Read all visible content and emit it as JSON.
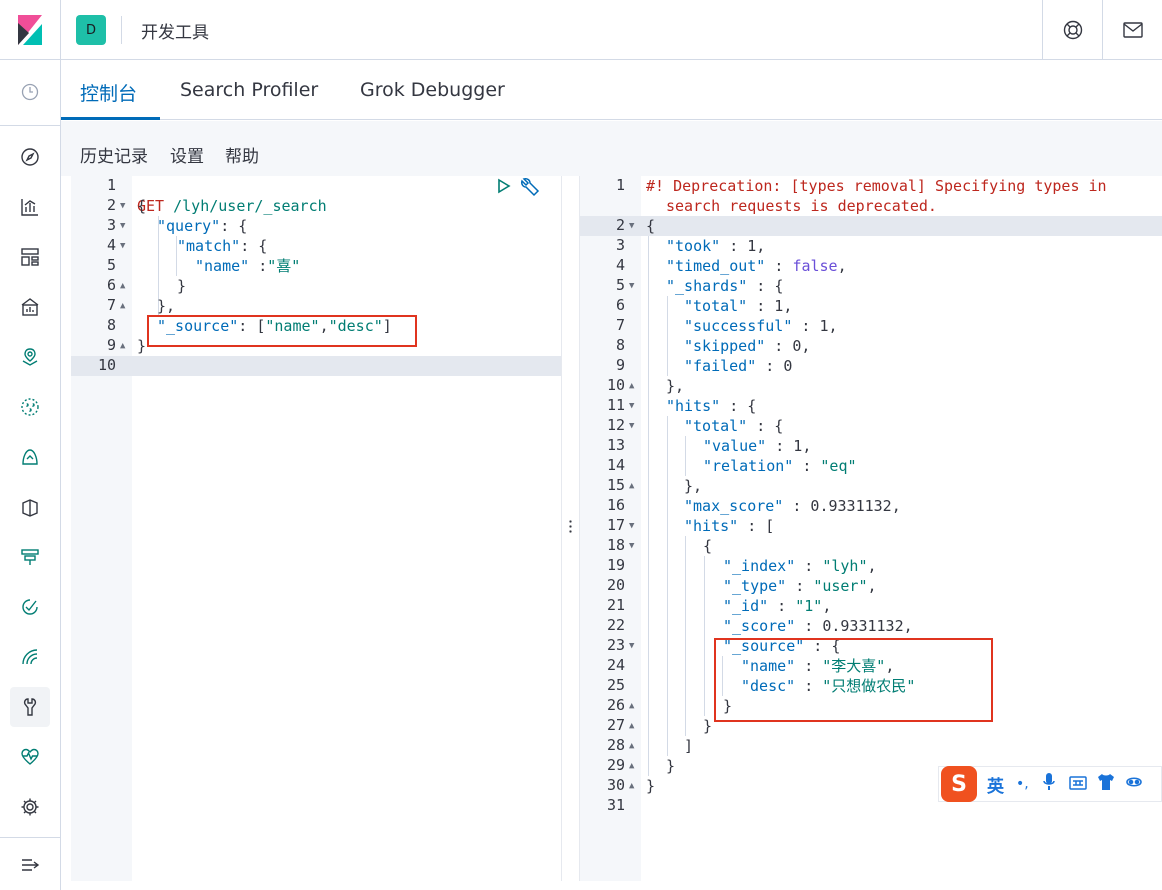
{
  "app": {
    "space_letter": "D",
    "breadcrumb": "开发工具"
  },
  "tabs": [
    {
      "label": "控制台"
    },
    {
      "label": "Search Profiler"
    },
    {
      "label": "Grok Debugger"
    }
  ],
  "subnav": {
    "history": "历史记录",
    "settings": "设置",
    "help": "帮助"
  },
  "request_lines": [
    "1",
    "2",
    "3",
    "4",
    "5",
    "6",
    "7",
    "8",
    "9",
    "10"
  ],
  "request_code": {
    "l1_method": "GET",
    "l1_path": " /lyh/user/_search",
    "l2": "{",
    "l3_key": "\"query\"",
    "l3_rest": ": {",
    "l4_key": "\"match\"",
    "l4_rest": ": {",
    "l5_key": "\"name\"",
    "l5_sep": " :",
    "l5_val": "\"喜\"",
    "l6": "}",
    "l7": "},",
    "l8_key": "\"_source\"",
    "l8_sep": ": [",
    "l8_v1": "\"name\"",
    "l8_comma": ",",
    "l8_v2": "\"desc\"",
    "l8_end": "]",
    "l9": "}"
  },
  "response_lines": [
    "1",
    "2",
    "3",
    "4",
    "5",
    "6",
    "7",
    "8",
    "9",
    "10",
    "11",
    "12",
    "13",
    "14",
    "15",
    "16",
    "17",
    "18",
    "19",
    "20",
    "21",
    "22",
    "23",
    "24",
    "25",
    "26",
    "27",
    "28",
    "29",
    "30",
    "31"
  ],
  "response_code": {
    "r1a": "#! Deprecation: [types removal] Specifying types in",
    "r1b": "search requests is deprecated.",
    "r2": "{",
    "r3k": "\"took\"",
    "r3v": " : 1,",
    "r4k": "\"timed_out\"",
    "r4s": " : ",
    "r4v": "false",
    "r4e": ",",
    "r5k": "\"_shards\"",
    "r5v": " : {",
    "r6k": "\"total\"",
    "r6v": " : 1,",
    "r7k": "\"successful\"",
    "r7v": " : 1,",
    "r8k": "\"skipped\"",
    "r8v": " : 0,",
    "r9k": "\"failed\"",
    "r9v": " : 0",
    "r10": "},",
    "r11k": "\"hits\"",
    "r11v": " : {",
    "r12k": "\"total\"",
    "r12v": " : {",
    "r13k": "\"value\"",
    "r13v": " : 1,",
    "r14k": "\"relation\"",
    "r14s": " : ",
    "r14v": "\"eq\"",
    "r15": "},",
    "r16k": "\"max_score\"",
    "r16v": " : 0.9331132,",
    "r17k": "\"hits\"",
    "r17v": " : [",
    "r18": "{",
    "r19k": "\"_index\"",
    "r19s": " : ",
    "r19v": "\"lyh\"",
    "r19e": ",",
    "r20k": "\"_type\"",
    "r20s": " : ",
    "r20v": "\"user\"",
    "r20e": ",",
    "r21k": "\"_id\"",
    "r21s": " : ",
    "r21v": "\"1\"",
    "r21e": ",",
    "r22k": "\"_score\"",
    "r22v": " : 0.9331132,",
    "r23k": "\"_source\"",
    "r23v": " : {",
    "r24k": "\"name\"",
    "r24s": " : ",
    "r24v": "\"李大喜\"",
    "r24e": ",",
    "r25k": "\"desc\"",
    "r25s": " : ",
    "r25v": "\"只想做农民\"",
    "r26": "}",
    "r27": "}",
    "r28": "]",
    "r29": "}",
    "r30": "}"
  },
  "ime": {
    "mode": "英",
    "punct": "•,"
  },
  "colors": {
    "accent": "#006bb8",
    "string": "#017d73",
    "highlight": "#e0341f"
  }
}
